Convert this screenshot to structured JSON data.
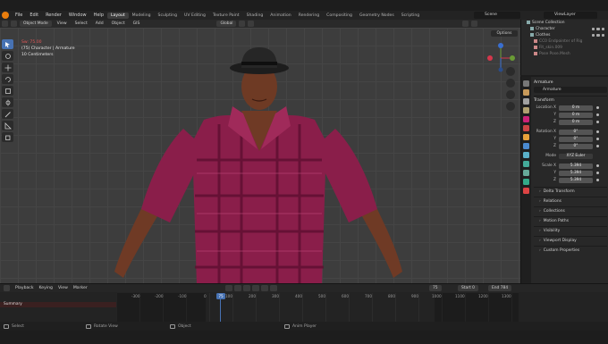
{
  "menu": {
    "items": [
      "File",
      "Edit",
      "Render",
      "Window",
      "Help"
    ],
    "workspaces": [
      "Layout",
      "Modeling",
      "Sculpting",
      "UV Editing",
      "Texture Paint",
      "Shading",
      "Animation",
      "Rendering",
      "Compositing",
      "Geometry Nodes",
      "Scripting"
    ],
    "active_workspace": "Layout",
    "scene": "Scene",
    "view_layer": "ViewLayer"
  },
  "viewport_header": {
    "mode": "Object Mode",
    "view": "View",
    "select": "Select",
    "add": "Add",
    "object": "Object",
    "gis": "GIS",
    "transform_orientation": "Global",
    "options": "Options"
  },
  "viewport": {
    "frame_label": "Sw: 75.00",
    "object_label": "(75) Character | Armature",
    "scale_label": "10 Centimeters"
  },
  "outliner": {
    "items": [
      {
        "label": "Scene Collection",
        "dim": false
      },
      {
        "label": "Character",
        "dim": false
      },
      {
        "label": "Clothes",
        "dim": false
      },
      {
        "label": "CC0 Endpointer of Rig",
        "dim": true
      },
      {
        "label": "Fit_skin.009",
        "dim": true
      },
      {
        "label": "Pose Pose.Mesh",
        "dim": true
      }
    ]
  },
  "properties": {
    "object_header": "Armature",
    "object_name": "Armature",
    "transform_label": "Transform",
    "location": {
      "label": "Location X",
      "x": "0 m",
      "y": "0 m",
      "z": "0 m"
    },
    "rotation": {
      "label": "Rotation X",
      "x": "0°",
      "y": "0°",
      "z": "0°"
    },
    "mode": {
      "label": "Mode",
      "value": "XYZ Euler"
    },
    "scale": {
      "label": "Scale X",
      "x": "5.394",
      "y": "5.394",
      "z": "5.394"
    },
    "axis_y": "Y",
    "axis_z": "Z",
    "subsections": [
      "Delta Transform",
      "Relations",
      "Collections",
      "Motion Paths",
      "Visibility",
      "Viewport Display",
      "Custom Properties"
    ]
  },
  "timeline": {
    "playback": "Playback",
    "keying": "Keying",
    "view": "View",
    "marker": "Marker",
    "current_frame": "75",
    "start_label": "Start",
    "start": "0",
    "end_label": "End",
    "end": "784",
    "summary": "Summary",
    "playhead": "75",
    "ruler_ticks": [
      "-300",
      "-200",
      "-100",
      "0",
      "100",
      "200",
      "300",
      "400",
      "500",
      "600",
      "700",
      "800",
      "900",
      "1000",
      "1100",
      "1200",
      "1300"
    ]
  },
  "statusbar": {
    "select": "Select",
    "rotate_view": "Rotate View",
    "object": "Object",
    "anim_player": "Anim Player"
  },
  "colors": {
    "accent": "#4772b3",
    "brand": "#e87d0d",
    "shirt": "#8a1e4a",
    "skin": "#6e3a24"
  }
}
